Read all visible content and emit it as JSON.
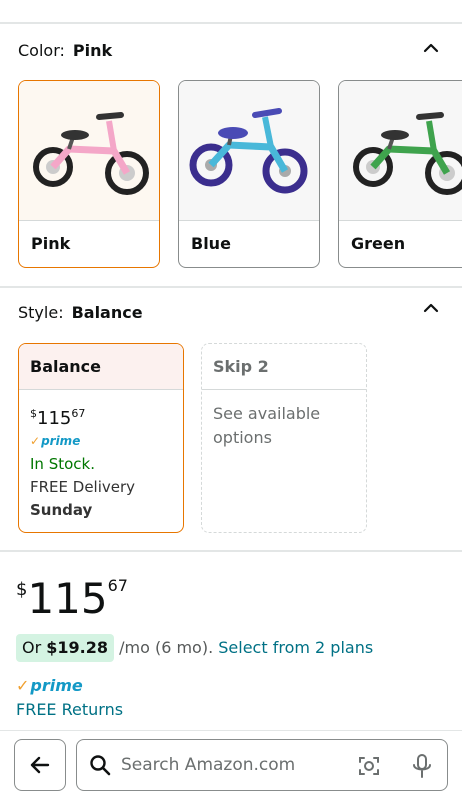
{
  "color_section": {
    "label": "Color:",
    "value": "Pink",
    "options": [
      {
        "name": "Pink",
        "frame": "#f4a7c8",
        "tire": "#222222",
        "seat": "#333333"
      },
      {
        "name": "Blue",
        "frame": "#49b8d9",
        "tire": "#3b2e8e",
        "seat": "#4a4bb5"
      },
      {
        "name": "Green",
        "frame": "#3fa34d",
        "tire": "#222222",
        "seat": "#333333"
      }
    ]
  },
  "style_section": {
    "label": "Style:",
    "value": "Balance",
    "options": [
      {
        "name": "Balance",
        "currency": "$",
        "price_whole": "115",
        "price_fraction": "67",
        "prime_label": "prime",
        "stock": "In Stock.",
        "delivery": "FREE Delivery",
        "delivery_day": "Sunday"
      },
      {
        "name": "Skip 2",
        "note": "See available options"
      }
    ]
  },
  "price": {
    "currency": "$",
    "whole": "115",
    "fraction": "67"
  },
  "installment": {
    "prefix": "Or",
    "amount": "$19.28",
    "term": "/mo (6 mo).",
    "link": "Select from 2 plans"
  },
  "prime_label": "prime",
  "free_returns": "FREE Returns",
  "search": {
    "placeholder": "Search Amazon.com"
  },
  "colors": {
    "accent_orange": "#e77600",
    "link_teal": "#007185",
    "prime_blue": "#1399c6",
    "in_stock_green": "#007600"
  }
}
